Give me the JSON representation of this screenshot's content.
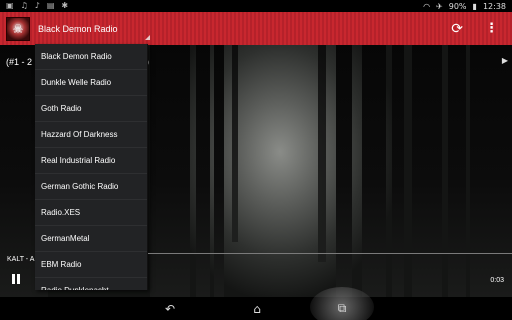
{
  "status_bar": {
    "left_icons": [
      "image-icon",
      "music-note-icon",
      "music-note-icon",
      "sd-card-icon",
      "bug-icon"
    ],
    "battery": "90%",
    "time": "12:38"
  },
  "app_bar": {
    "station_selected": "Black Demon Radio",
    "refresh_icon": "refresh-icon",
    "overflow_icon": "overflow-menu-icon"
  },
  "song": {
    "title_prefix": "(#1 - 2",
    "title_suffix": "p"
  },
  "station_list": [
    "Black Demon Radio",
    "Dunkle Welle Radio",
    "Goth Radio",
    "Hazzard Of Darkness",
    "Real Industrial Radio",
    "German Gothic Radio",
    "Radio.XES",
    "GermanMetal",
    "EBM Radio",
    "Radio Dunklenacht"
  ],
  "player": {
    "now_playing": "KALT - A",
    "elapsed": "0:03",
    "progress": 0.0
  },
  "nav_bar": {
    "back_icon": "back-icon",
    "home_icon": "home-icon",
    "recents_icon": "recents-icon"
  }
}
